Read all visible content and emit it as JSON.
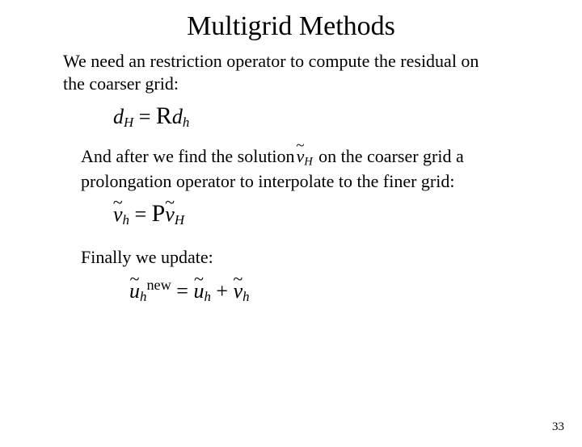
{
  "title": "Multigrid Methods",
  "para1": "We need an restriction operator to compute the residual on the coarser grid:",
  "eq1": {
    "lhs_var": "d",
    "lhs_sub": "H",
    "op": "R",
    "rhs_var": "d",
    "rhs_sub": "h"
  },
  "para2_pre": "And after we find the solution",
  "para2_inline": {
    "var": "v",
    "sub": "H",
    "tilde": "~"
  },
  "para2_post": " on the coarser grid a prolongation operator to interpolate to the finer grid:",
  "eq2": {
    "lhs_var": "v",
    "lhs_sub": "h",
    "tilde": "~",
    "op": "P",
    "rhs_var": "v",
    "rhs_sub": "H"
  },
  "para3": "Finally we update:",
  "eq3": {
    "lhs_var": "u",
    "lhs_sub": "h",
    "lhs_sup": "new",
    "tilde": "~",
    "eq": "=",
    "t1_var": "u",
    "t1_sub": "h",
    "plus": "+",
    "t2_var": "v",
    "t2_sub": "h"
  },
  "page_number": "33"
}
